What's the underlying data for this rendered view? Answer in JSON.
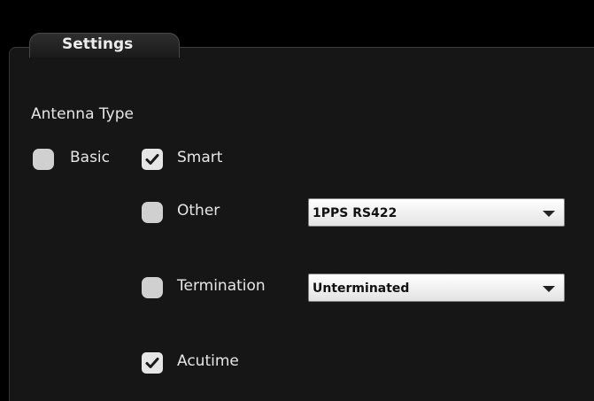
{
  "panel": {
    "title": "Settings"
  },
  "antenna": {
    "heading": "Antenna Type",
    "basic": {
      "label": "Basic",
      "checked": false
    },
    "smart": {
      "label": "Smart",
      "checked": true
    },
    "other": {
      "label": "Other",
      "checked": false,
      "select_value": "1PPS RS422"
    },
    "termination": {
      "label": "Termination",
      "checked": false,
      "select_value": "Unterminated"
    },
    "acutime": {
      "label": "Acutime",
      "checked": true
    }
  }
}
